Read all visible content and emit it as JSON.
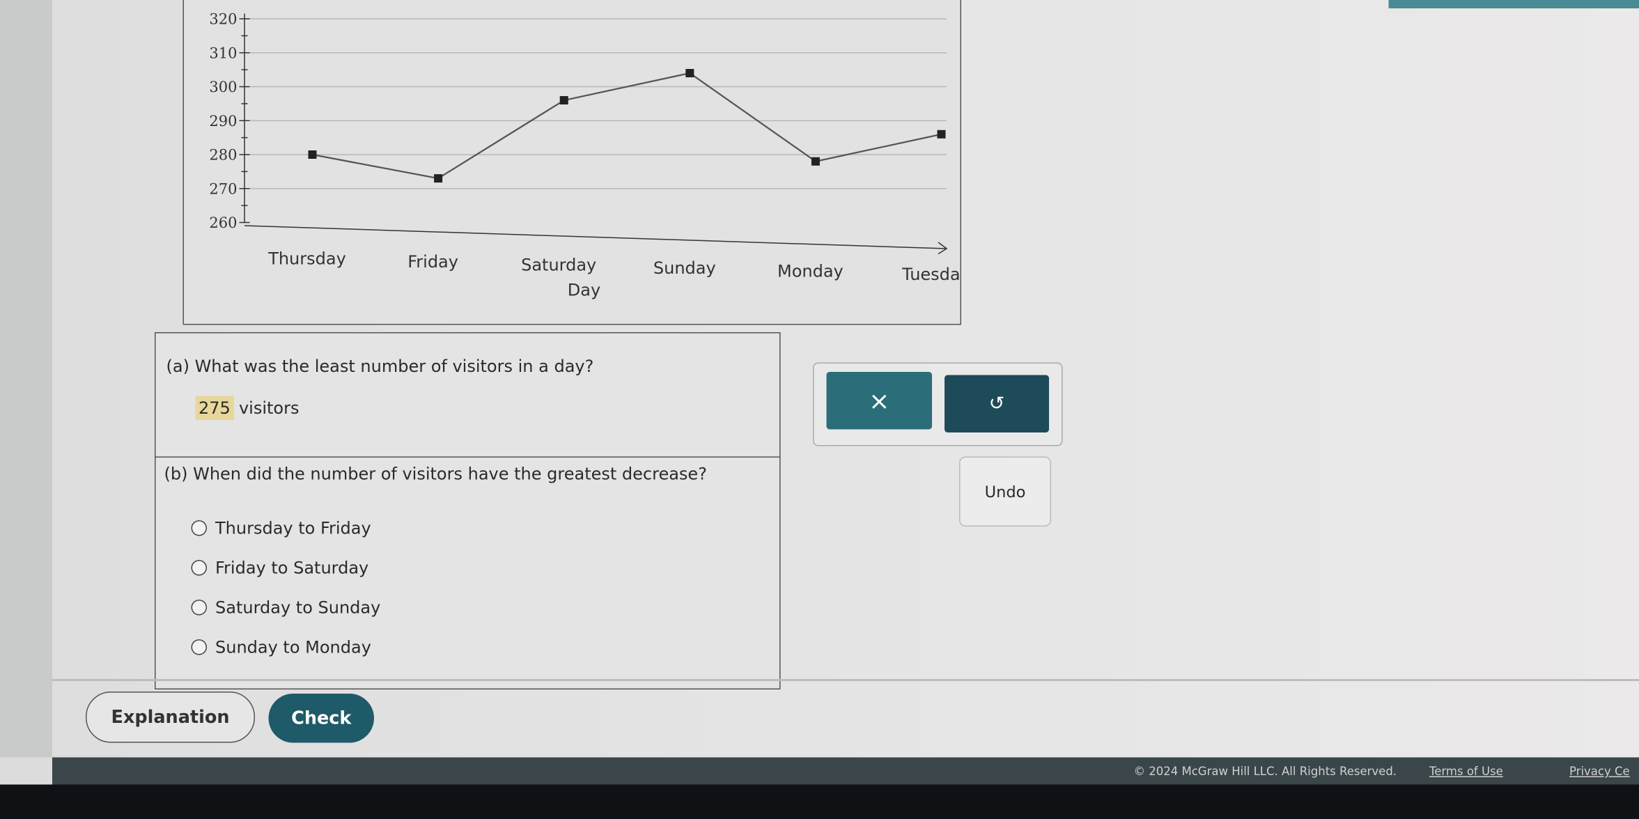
{
  "chart_data": {
    "type": "line",
    "xlabel": "Day",
    "ylabel": "",
    "categories": [
      "Thursday",
      "Friday",
      "Saturday",
      "Sunday",
      "Monday",
      "Tuesday"
    ],
    "values": [
      280,
      273,
      296,
      304,
      278,
      286
    ],
    "ylim": [
      260,
      320
    ],
    "yticks": [
      "260",
      "270",
      "280",
      "290",
      "300",
      "310",
      "320"
    ],
    "grid": true
  },
  "question_a": {
    "text": "(a) What was the least number of visitors in a day?",
    "answer_value": "275",
    "answer_unit": "visitors"
  },
  "question_b": {
    "text": "(b) When did the number of visitors have the greatest decrease?",
    "options": [
      "Thursday to Friday",
      "Friday to Saturday",
      "Saturday to Sunday",
      "Sunday to Monday"
    ]
  },
  "buttons": {
    "clear_symbol": "×",
    "undo_symbol": "↺",
    "undo_tooltip": "Undo",
    "explanation": "Explanation",
    "check": "Check"
  },
  "footer": {
    "copyright": "© 2024 McGraw Hill LLC. All Rights Reserved.",
    "terms": "Terms of Use",
    "privacy": "Privacy Ce"
  },
  "colors": {
    "primary": "#2b6d79",
    "primary_dark": "#1d4b5a",
    "answer_highlight": "#e8d79a"
  }
}
